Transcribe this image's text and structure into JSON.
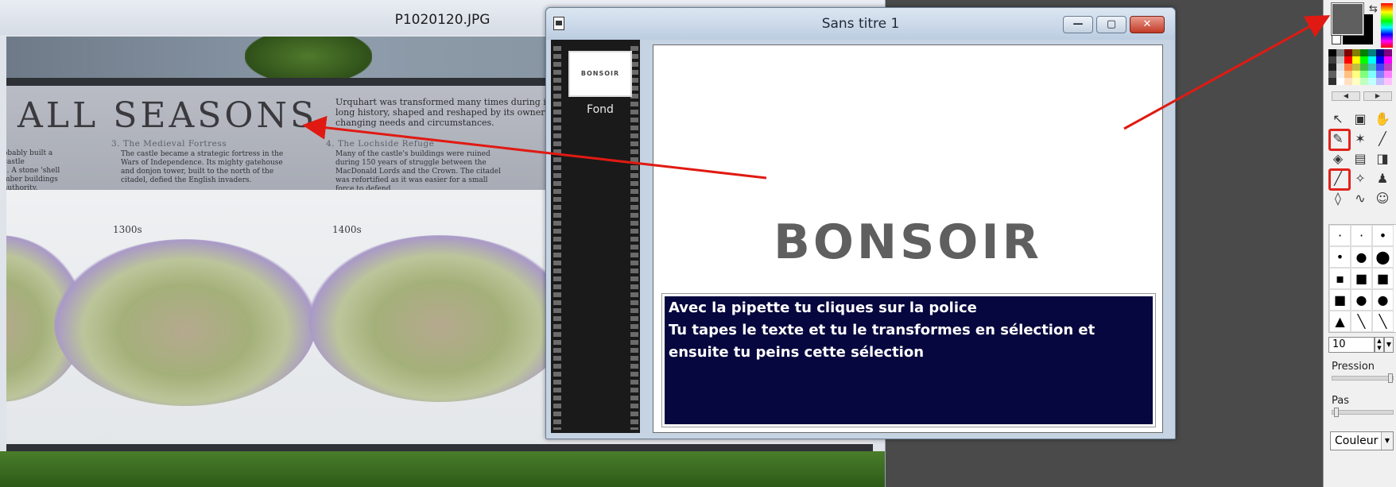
{
  "background_window": {
    "title": "P1020120.JPG",
    "photo": {
      "headline": "ALL SEASONS",
      "intro": "Urquhart was transformed many times during its long history, shaped and reshaped by its owners' changing needs and circumstances.",
      "left_fragment": "obably built a castle\ns. A stone 'shell\nmber buildings\nauthority.",
      "section3_title": "3. The Medieval Fortress",
      "section3_text": "The castle became a strategic fortress in the Wars of Independence. Its mighty gatehouse and donjon tower, built to the north of the citadel, defied the English invaders.",
      "section4_title": "4. The Lochside Refuge",
      "section4_text": "Many of the castle's buildings were ruined during 150 years of struggle between the MacDonald Lords and the Crown. The citadel was refortified as it was easier for a small force to defend.",
      "era1": "1300s",
      "era2": "1400s"
    }
  },
  "image_window": {
    "title": "Sans titre 1",
    "buttons": {
      "minimize": "—",
      "maximize": "▢",
      "close": "✕"
    },
    "layer": {
      "thumb_text": "BONSOIR",
      "label": "Fond"
    },
    "canvas": {
      "heading": "BONSOIR",
      "note_lines": [
        "Avec la pipette tu cliques sur la police",
        "Tu tapes le texte et tu le transformes en sélection et",
        "ensuite tu peins cette sélection"
      ]
    }
  },
  "tool_panel": {
    "foreground_color": "#5f5f5f",
    "background_color": "#000000",
    "palette": [
      "#000000",
      "#808080",
      "#800000",
      "#808000",
      "#008000",
      "#008080",
      "#000080",
      "#800080",
      "#404040",
      "#c0c0c0",
      "#ff0000",
      "#ffff00",
      "#00ff00",
      "#00ffff",
      "#0000ff",
      "#ff00ff",
      "#202020",
      "#e0e0e0",
      "#ff8040",
      "#c0c040",
      "#40c040",
      "#40c0c0",
      "#4040ff",
      "#c040c0",
      "#606060",
      "#f0f0f0",
      "#ffc080",
      "#ffff80",
      "#80ff80",
      "#80ffff",
      "#8080ff",
      "#ff80ff",
      "#303030",
      "#ffffff",
      "#ffe0c0",
      "#ffffc0",
      "#c0ffc0",
      "#c0ffff",
      "#c0c0ff",
      "#ffc0ff"
    ],
    "palette_nav": {
      "prev": "◀",
      "next": "▶"
    },
    "tools": [
      {
        "name": "select-arrow-icon",
        "glyph": "↖",
        "highlight": false
      },
      {
        "name": "image-select-icon",
        "glyph": "▣",
        "highlight": false
      },
      {
        "name": "hand-icon",
        "glyph": "✋",
        "highlight": false
      },
      {
        "name": "eyedropper-icon",
        "glyph": "✎",
        "highlight": true
      },
      {
        "name": "magic-wand-icon",
        "glyph": "✶",
        "highlight": false
      },
      {
        "name": "line-icon",
        "glyph": "╱",
        "highlight": false
      },
      {
        "name": "fill-bucket-icon",
        "glyph": "◈",
        "highlight": false
      },
      {
        "name": "spray-bottle-icon",
        "glyph": "▤",
        "highlight": false
      },
      {
        "name": "eraser-icon",
        "glyph": "◨",
        "highlight": false
      },
      {
        "name": "brush-icon",
        "glyph": "╱",
        "highlight": true
      },
      {
        "name": "airbrush-icon",
        "glyph": "✧",
        "highlight": false
      },
      {
        "name": "stamp-icon",
        "glyph": "♟",
        "highlight": false
      },
      {
        "name": "drop-icon",
        "glyph": "◊",
        "highlight": false
      },
      {
        "name": "smudge-icon",
        "glyph": "∿",
        "highlight": false
      },
      {
        "name": "portrait-icon",
        "glyph": "☺",
        "highlight": false
      }
    ],
    "brushes": [
      "·",
      "·",
      "•",
      "•",
      "●",
      "⬤",
      "▪",
      "■",
      "■",
      "■",
      "●",
      "●",
      "▲",
      "╲",
      "╲"
    ],
    "size_value": "10",
    "pression_label": "Pression",
    "pas_label": "Pas",
    "mode_value": "Couleur"
  }
}
